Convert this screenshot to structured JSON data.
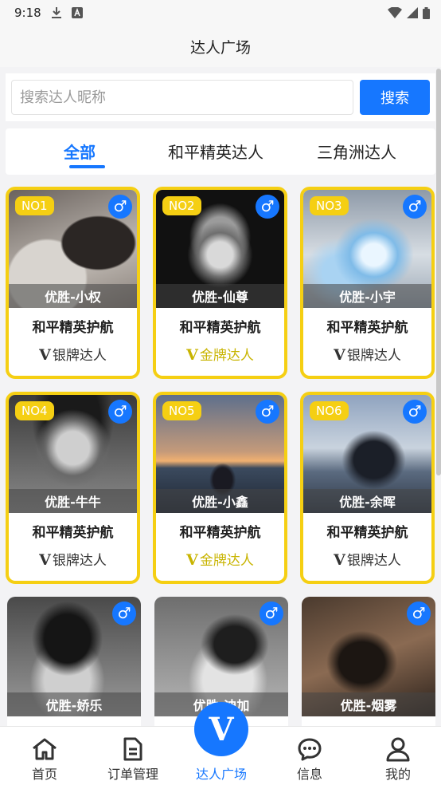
{
  "status_bar": {
    "time": "9:18"
  },
  "header": {
    "title": "达人广场"
  },
  "search": {
    "placeholder": "搜索达人昵称",
    "button_label": "搜索"
  },
  "tabs": [
    {
      "label": "全部",
      "active": true
    },
    {
      "label": "和平精英达人",
      "active": false
    },
    {
      "label": "三角洲达人",
      "active": false
    }
  ],
  "cards": [
    {
      "rank": "NO1",
      "name": "优胜-小权",
      "game": "和平精英护航",
      "level_icon": "V",
      "level": "银牌达人",
      "tier": "silver"
    },
    {
      "rank": "NO2",
      "name": "优胜-仙尊",
      "game": "和平精英护航",
      "level_icon": "V",
      "level": "金牌达人",
      "tier": "gold"
    },
    {
      "rank": "NO3",
      "name": "优胜-小宇",
      "game": "和平精英护航",
      "level_icon": "V",
      "level": "银牌达人",
      "tier": "silver"
    },
    {
      "rank": "NO4",
      "name": "优胜-牛牛",
      "game": "和平精英护航",
      "level_icon": "V",
      "level": "银牌达人",
      "tier": "silver"
    },
    {
      "rank": "NO5",
      "name": "优胜-小鑫",
      "game": "和平精英护航",
      "level_icon": "V",
      "level": "金牌达人",
      "tier": "gold"
    },
    {
      "rank": "NO6",
      "name": "优胜-余晖",
      "game": "和平精英护航",
      "level_icon": "V",
      "level": "银牌达人",
      "tier": "silver"
    },
    {
      "name": "优胜-娇乐"
    },
    {
      "name": "优胜-迪加"
    },
    {
      "name": "优胜-烟雾"
    }
  ],
  "gender_symbol": "♂",
  "bottom_nav": {
    "items": [
      {
        "label": "首页",
        "icon": "home-icon"
      },
      {
        "label": "订单管理",
        "icon": "document-icon"
      },
      {
        "label": "达人广场",
        "icon": "v-logo-icon",
        "active": true
      },
      {
        "label": "信息",
        "icon": "chat-icon"
      },
      {
        "label": "我的",
        "icon": "user-icon"
      }
    ],
    "center_logo": "V"
  },
  "colors": {
    "accent": "#1677ff",
    "card_border": "#f5cf13",
    "gold_text": "#c8b400"
  }
}
